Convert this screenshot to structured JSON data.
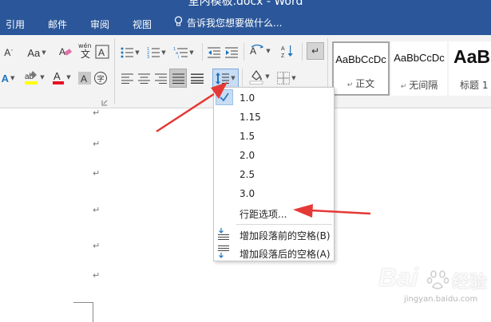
{
  "titlebar": {
    "doc_title": "室内模板.docx - Word",
    "tabs": [
      "引用",
      "邮件",
      "审阅",
      "视图"
    ],
    "tell_me": "告诉我您想要做什么..."
  },
  "ribbon": {
    "font_button_label": "Aa",
    "style_gallery": [
      {
        "sample": "AaBbCcDc",
        "name": "正文"
      },
      {
        "sample": "AaBbCcDc",
        "name": "无间隔"
      },
      {
        "sample": "AaBb",
        "name": "标题 1"
      }
    ]
  },
  "line_spacing_menu": {
    "items": [
      "1.0",
      "1.15",
      "1.5",
      "2.0",
      "2.5",
      "3.0",
      "行距选项..."
    ],
    "checked_item": "1.0",
    "add_before": "增加段落前的空格(B)",
    "add_after": "增加段落后的空格(A)"
  },
  "document": {
    "paragraph_mark": "↵"
  },
  "watermark": {
    "brand": "Bai",
    "brand_tail": "经验",
    "url": "jingyan.baidu.com"
  },
  "colors": {
    "title_bar": "#2b579a",
    "ribbon": "#f3f3f3",
    "highlight": "#ffff00",
    "font_color": "#e81123",
    "annotation_arrow": "#e53935"
  }
}
